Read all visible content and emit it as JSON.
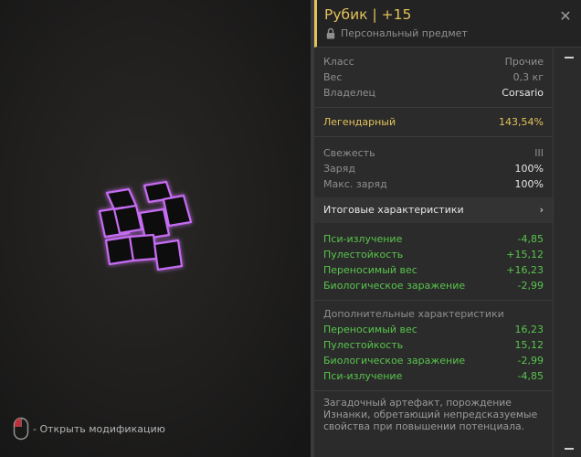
{
  "header": {
    "title": "Рубик | +15",
    "personal_label": "Персональный предмет",
    "close_icon": "close-icon",
    "lock_icon": "lock-icon",
    "accent_color": "#e3c25b"
  },
  "base_info": [
    {
      "label": "Класс",
      "value": "Прочие"
    },
    {
      "label": "Вес",
      "value": "0,3 кг"
    },
    {
      "label": "Владелец",
      "value": "Corsario"
    }
  ],
  "rarity": {
    "label": "Легендарный",
    "value": "143,54%"
  },
  "condition": [
    {
      "label": "Свежесть",
      "value": "III"
    },
    {
      "label": "Заряд",
      "value": "100%"
    },
    {
      "label": "Макс. заряд",
      "value": "100%"
    }
  ],
  "summary": {
    "title": "Итоговые характеристики",
    "chevron": "›",
    "stats": [
      {
        "label": "Пси-излучение",
        "value": "-4,85"
      },
      {
        "label": "Пулестойкость",
        "value": "+15,12"
      },
      {
        "label": "Переносимый вес",
        "value": "+16,23"
      },
      {
        "label": "Биологическое заражение",
        "value": "-2,99"
      }
    ]
  },
  "additional": {
    "title": "Дополнительные характеристики",
    "stats": [
      {
        "label": "Переносимый вес",
        "value": "16,23"
      },
      {
        "label": "Пулестойкость",
        "value": "15,12"
      },
      {
        "label": "Биологическое заражение",
        "value": "-2,99"
      },
      {
        "label": "Пси-излучение",
        "value": "-4,85"
      }
    ]
  },
  "description": "Загадочный артефакт, порождение Изнанки, обретающий непредсказуемые свойства при повышении потенциала.",
  "hint": {
    "icon": "mouse-icon",
    "text": "- Открыть модификацию"
  },
  "stat_color": "#58c44c"
}
